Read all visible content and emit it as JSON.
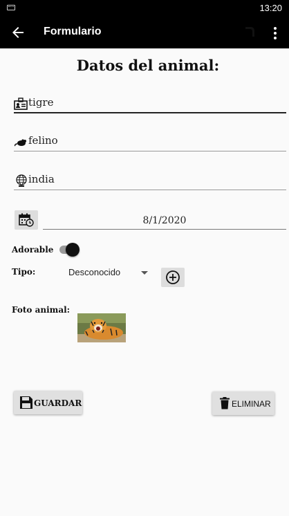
{
  "status_bar": {
    "time": "13:20",
    "keyboard_icon": "keyboard-icon"
  },
  "app_bar": {
    "title": "Formulario",
    "back_icon": "arrow-left-icon",
    "menu_icon": "more-vert-icon"
  },
  "form": {
    "heading": "Datos del animal:",
    "name_field": {
      "value": "tigre",
      "icon": "id-card-icon"
    },
    "family_field": {
      "value": "felino",
      "icon": "rat-icon"
    },
    "origin_field": {
      "value": "india",
      "icon": "globe-icon"
    },
    "date_field": {
      "value": "8/1/2020",
      "icon": "calendar-clock-icon"
    },
    "adorable": {
      "label": "Adorable",
      "checked": true
    },
    "tipo": {
      "label": "Tipo:",
      "selected": "Desconocido",
      "add_icon": "plus-circle-icon"
    },
    "photo": {
      "label": "Foto animal:",
      "image": "tiger-photo"
    }
  },
  "actions": {
    "save_label": "GUARDAR",
    "save_icon": "floppy-disk-icon",
    "delete_label": "ELIMINAR",
    "delete_icon": "trash-icon"
  },
  "colors": {
    "app_bar": "#000000",
    "background": "#fafafa",
    "button": "#e0e0e0",
    "switch_thumb": "#111111"
  }
}
